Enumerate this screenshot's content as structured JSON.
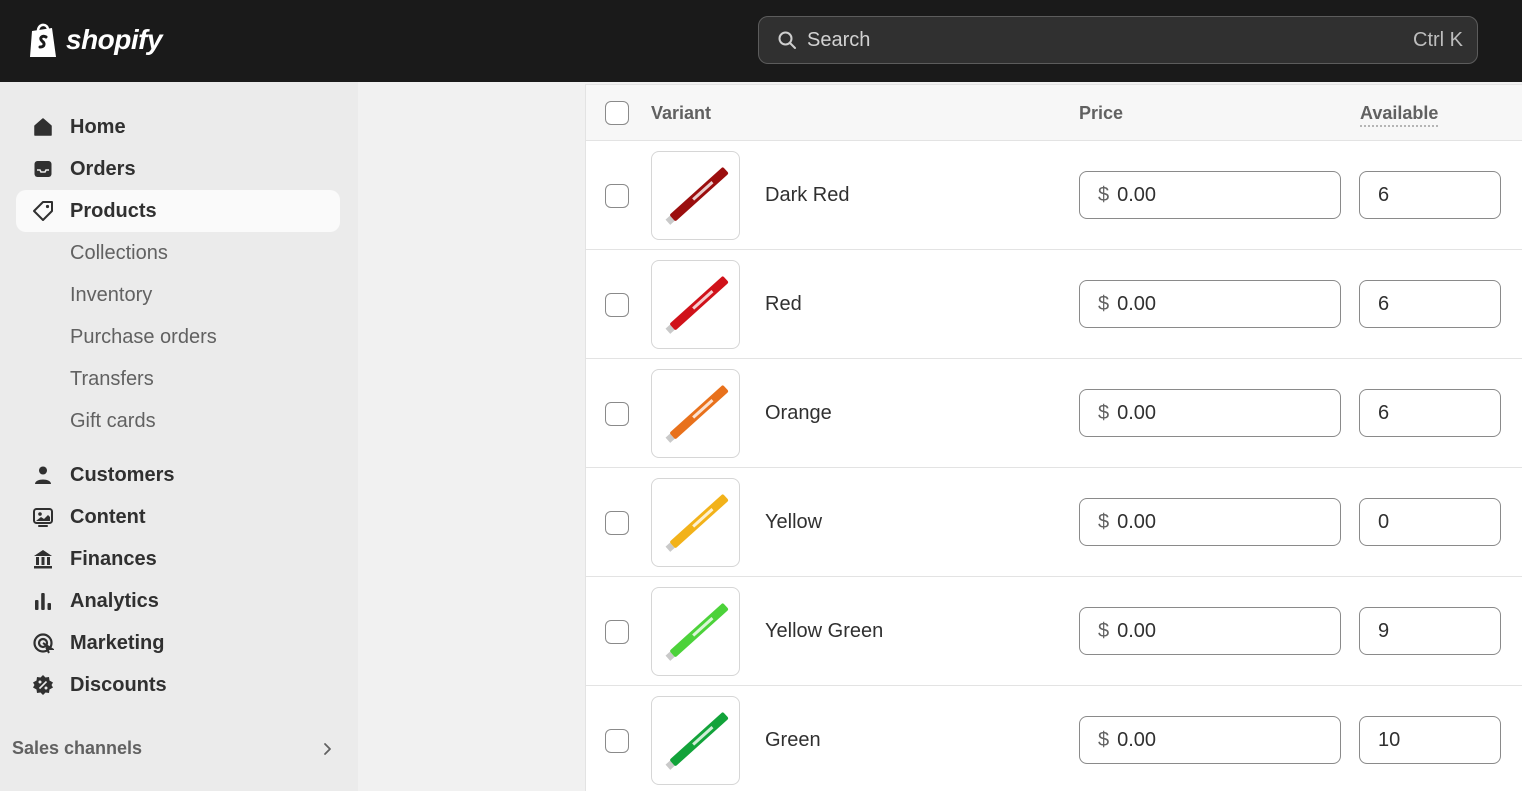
{
  "brand": {
    "name": "shopify"
  },
  "search": {
    "placeholder": "Search",
    "shortcut": "Ctrl K"
  },
  "sidebar": {
    "items": [
      {
        "label": "Home",
        "icon": "home-icon",
        "active": false
      },
      {
        "label": "Orders",
        "icon": "inbox-icon",
        "active": false
      },
      {
        "label": "Products",
        "icon": "tag-icon",
        "active": true
      }
    ],
    "product_subitems": [
      "Collections",
      "Inventory",
      "Purchase orders",
      "Transfers",
      "Gift cards"
    ],
    "items2": [
      {
        "label": "Customers",
        "icon": "person-icon"
      },
      {
        "label": "Content",
        "icon": "image-icon"
      },
      {
        "label": "Finances",
        "icon": "bank-icon"
      },
      {
        "label": "Analytics",
        "icon": "bar-chart-icon"
      },
      {
        "label": "Marketing",
        "icon": "target-icon"
      },
      {
        "label": "Discounts",
        "icon": "discount-badge-icon"
      }
    ],
    "sales_channels": "Sales channels"
  },
  "table": {
    "headers": {
      "variant": "Variant",
      "price": "Price",
      "available": "Available"
    },
    "rows": [
      {
        "name": "Dark Red",
        "currency": "$",
        "price": "0.00",
        "available": "6",
        "color": "#9b0e0e"
      },
      {
        "name": "Red",
        "currency": "$",
        "price": "0.00",
        "available": "6",
        "color": "#d0121a"
      },
      {
        "name": "Orange",
        "currency": "$",
        "price": "0.00",
        "available": "6",
        "color": "#e8711c"
      },
      {
        "name": "Yellow",
        "currency": "$",
        "price": "0.00",
        "available": "0",
        "color": "#f2b21a"
      },
      {
        "name": "Yellow Green",
        "currency": "$",
        "price": "0.00",
        "available": "9",
        "color": "#4cd23a"
      },
      {
        "name": "Green",
        "currency": "$",
        "price": "0.00",
        "available": "10",
        "color": "#12a33a"
      }
    ]
  }
}
